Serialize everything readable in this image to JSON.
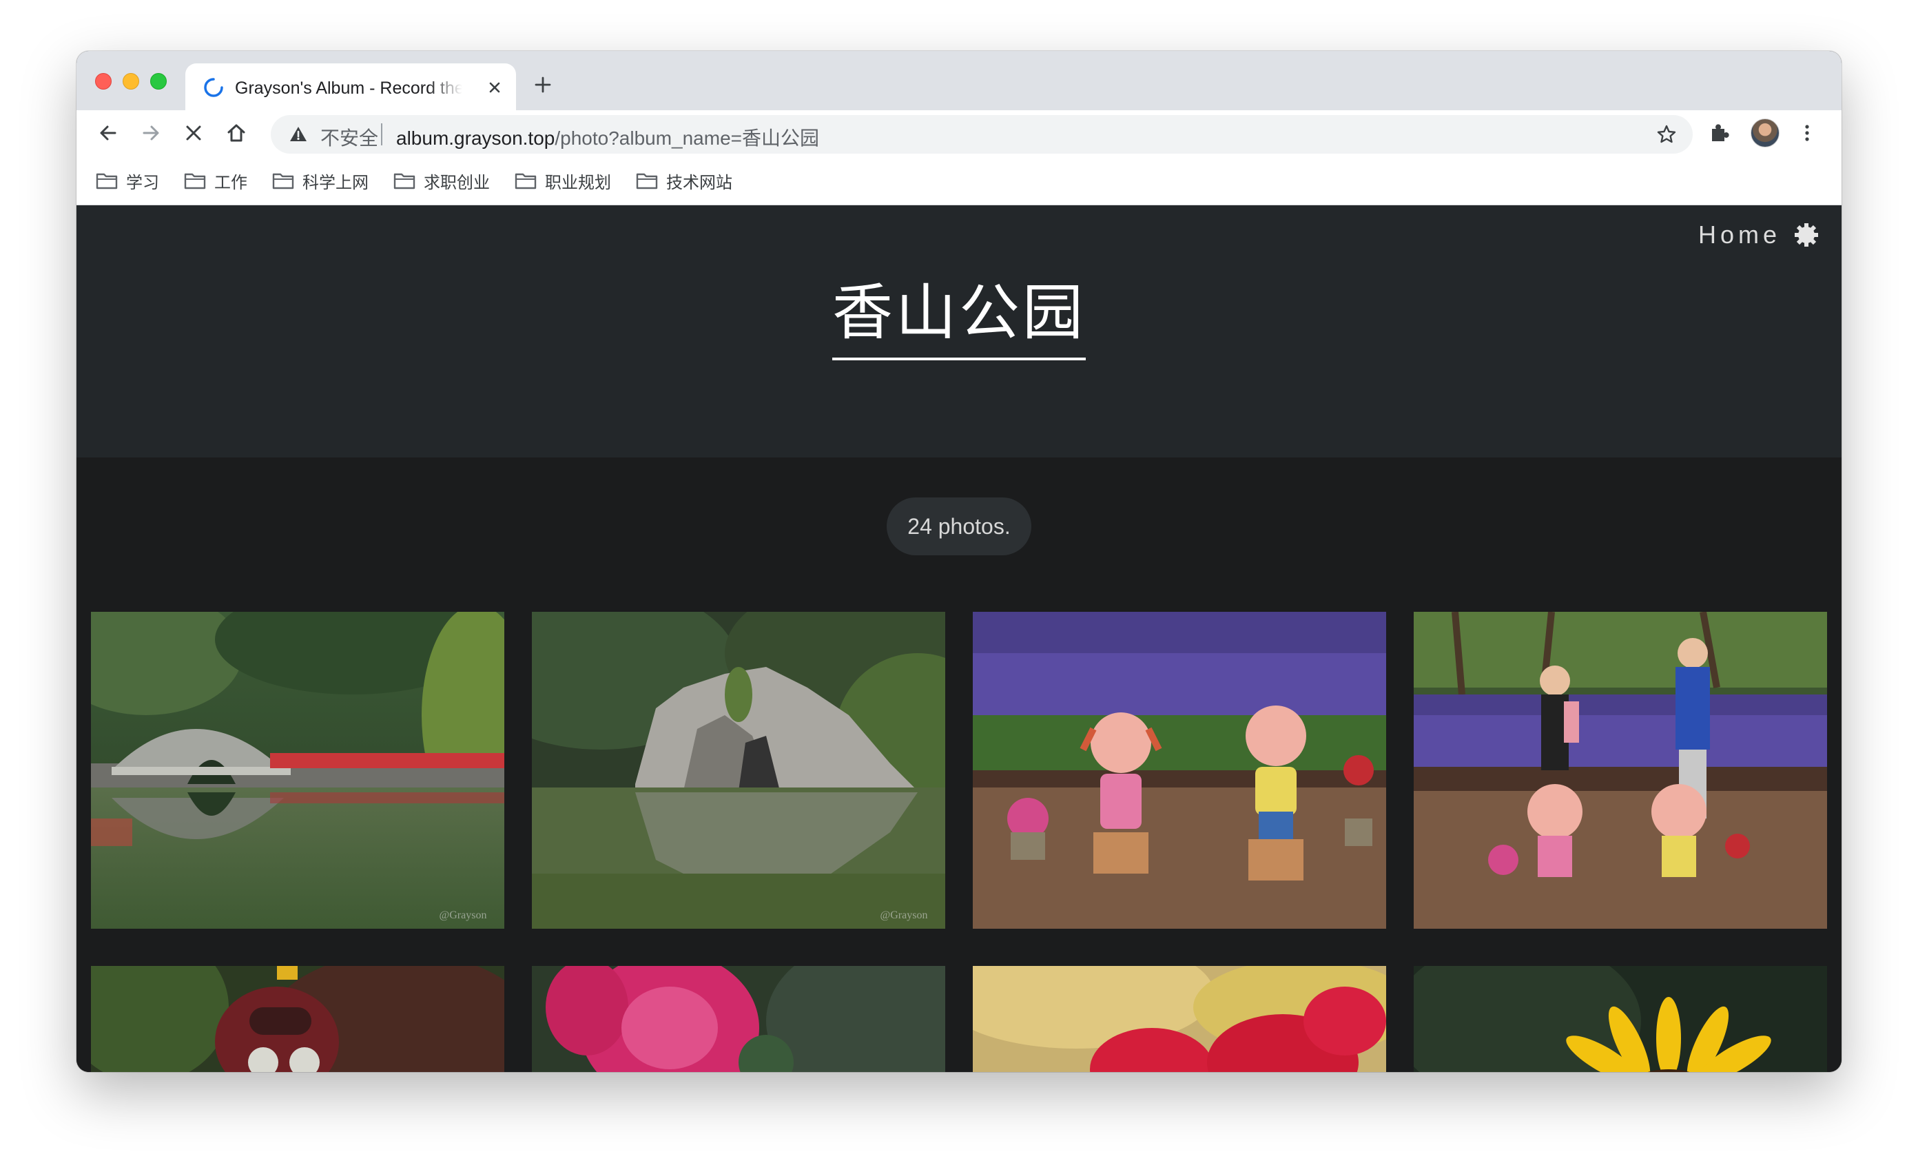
{
  "browser": {
    "tab": {
      "title": "Grayson's Album - Record the beautiful moments"
    },
    "address": {
      "security_label": "不安全",
      "url_host": "album.grayson.top",
      "url_path": "/photo?album_name=香山公园"
    },
    "bookmarks": [
      "学习",
      "工作",
      "科学上网",
      "求职创业",
      "职业规划",
      "技术网站"
    ]
  },
  "page": {
    "nav": {
      "home_label": "Home"
    },
    "album_title": "香山公园",
    "photo_count": "24 photos.",
    "photos": [
      {
        "watermark": "@Grayson"
      },
      {
        "watermark": "@Grayson"
      },
      {
        "watermark": ""
      },
      {
        "watermark": ""
      },
      {
        "watermark": ""
      },
      {
        "watermark": ""
      },
      {
        "watermark": ""
      },
      {
        "watermark": ""
      }
    ]
  },
  "colors": {
    "header_bg": "#23272a",
    "body_bg": "#1b1c1d",
    "tabstrip_bg": "#dee1e6",
    "spinner_blue": "#1a73e8"
  }
}
